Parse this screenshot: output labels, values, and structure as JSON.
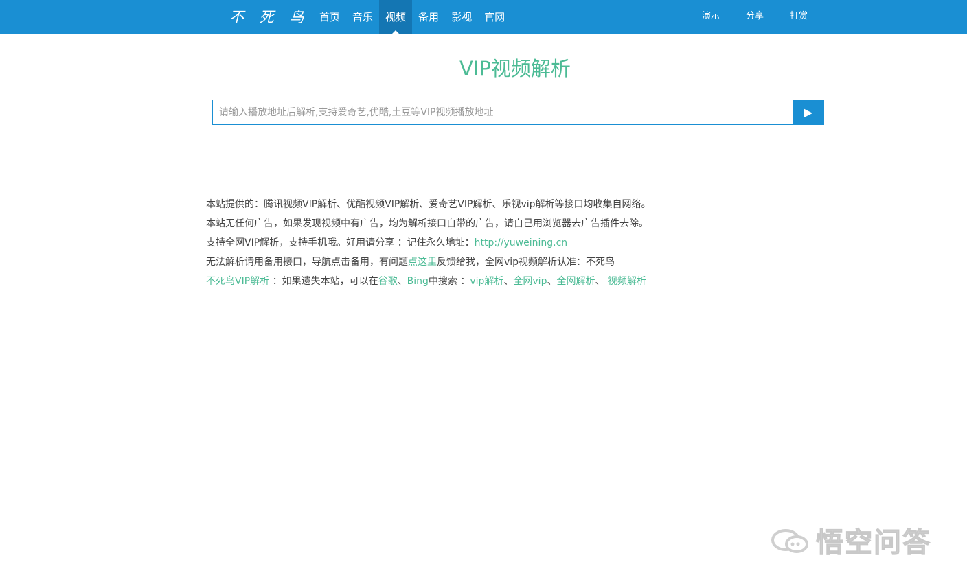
{
  "header": {
    "brand": "不 死 鸟",
    "nav_left": [
      {
        "label": "首页"
      },
      {
        "label": "音乐"
      },
      {
        "label": "视频",
        "active": true
      },
      {
        "label": "备用"
      },
      {
        "label": "影视"
      },
      {
        "label": "官网"
      }
    ],
    "nav_right": [
      {
        "label": "演示"
      },
      {
        "label": "分享"
      },
      {
        "label": "打赏"
      }
    ],
    "colors": {
      "bar": "#1a8fd3",
      "active": "#1476b3"
    }
  },
  "main": {
    "title": "VIP视频解析",
    "title_color": "#4cbb95",
    "search": {
      "placeholder": "请输入播放地址后解析,支持爱奇艺,优酷,土豆等VIP视频播放地址",
      "value": "",
      "button_icon": "play-icon",
      "button_glyph": "▶"
    }
  },
  "info": {
    "line1": "本站提供的：腾讯视频VIP解析、优酷视频VIP解析、爱奇艺VIP解析、乐视vip解析等接口均收集自网络。",
    "line2": "本站无任何广告，如果发现视频中有广告，均为解析接口自带的广告，请自己用浏览器去广告插件去除。",
    "line3_prefix": "支持全网VIP解析，支持手机哦。好用请分享 ：记住永久地址：",
    "line3_link": "http://yuweining.cn",
    "line4_prefix": "无法解析请用备用接口，导航点击备用，有问题",
    "line4_link": "点这里",
    "line4_suffix": "反馈给我，全网vip视频解析认准：不死鸟",
    "line5": {
      "brand_link": "不死鸟VIP解析",
      "text1": " ：如果遗失本站，可以在",
      "link_google": "谷歌",
      "sep1": "、",
      "link_bing": "Bing",
      "text2": "中搜索 ：",
      "kw1": "vip解析",
      "sep2": "、",
      "kw2": "全网vip",
      "sep3": "、",
      "kw3": "全网解析",
      "sep4": "、 ",
      "kw4": "视频解析"
    },
    "link_color": "#4cbb95"
  },
  "watermark": {
    "icon": "chat-bubbles-icon",
    "text": "悟空问答"
  }
}
